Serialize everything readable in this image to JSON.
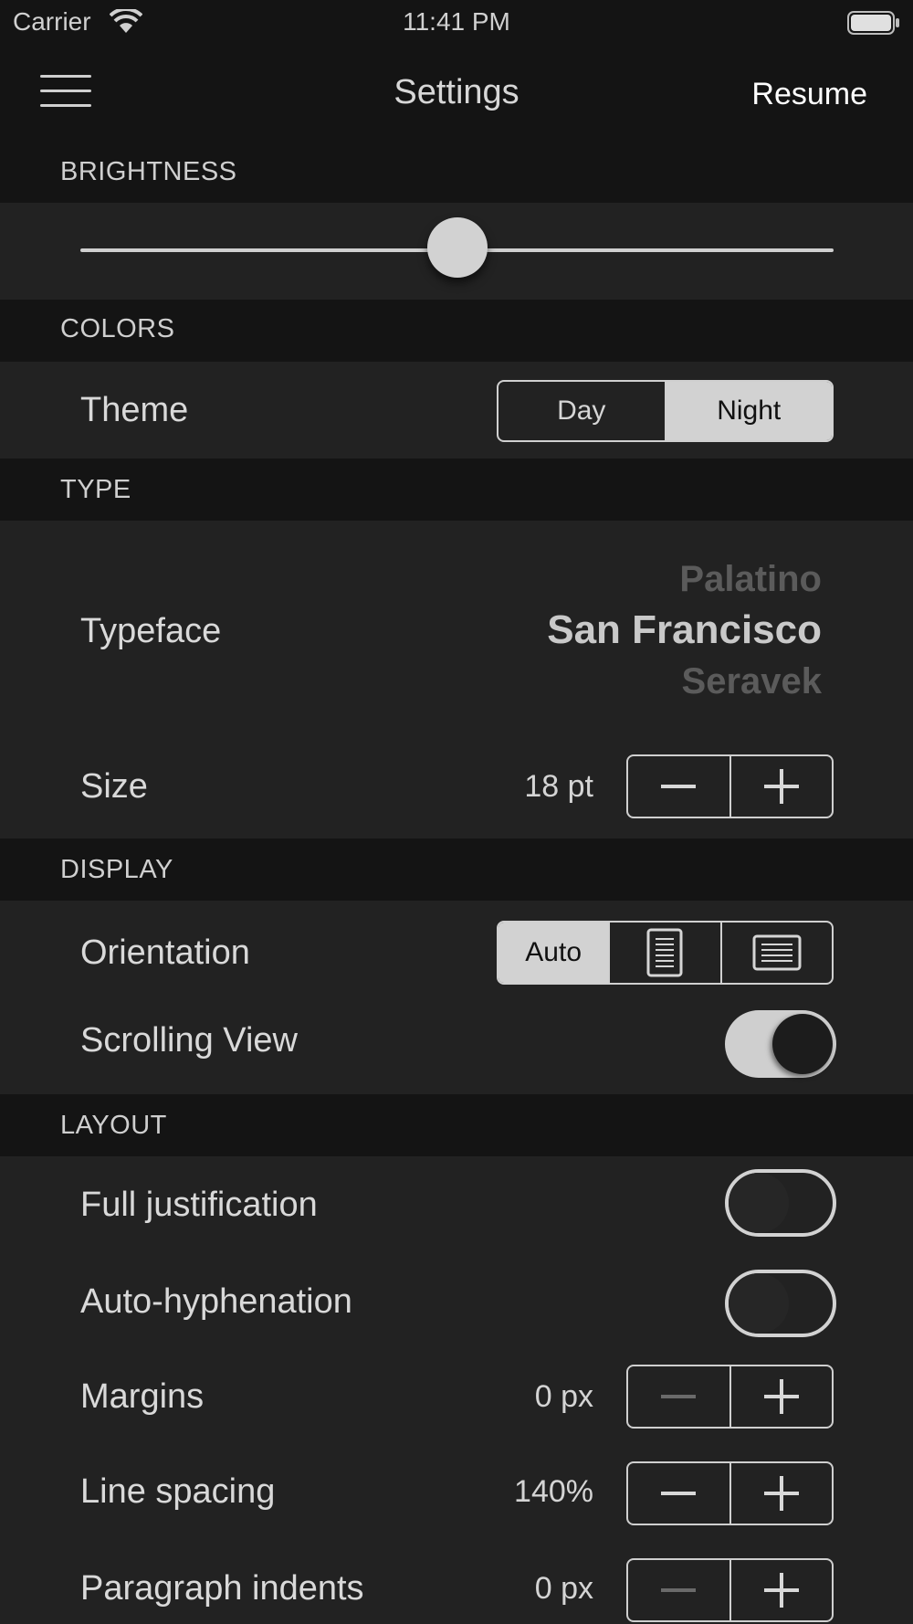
{
  "status_bar": {
    "carrier": "Carrier",
    "time": "11:41 PM"
  },
  "nav": {
    "title": "Settings",
    "resume": "Resume"
  },
  "sections": {
    "brightness": "BRIGHTNESS",
    "colors": "COLORS",
    "type": "TYPE",
    "display": "DISPLAY",
    "layout": "LAYOUT"
  },
  "brightness": {
    "level": 0.5
  },
  "colors": {
    "theme_label": "Theme",
    "theme_options": [
      "Day",
      "Night"
    ],
    "theme_selected": "Night"
  },
  "type": {
    "typeface_label": "Typeface",
    "typeface_above": "Palatino",
    "typeface_selected": "San Francisco",
    "typeface_below": "Seravek",
    "size_label": "Size",
    "size_value": "18 pt"
  },
  "display": {
    "orientation_label": "Orientation",
    "orientation_auto": "Auto",
    "orientation_selected": "Auto",
    "scrolling_label": "Scrolling View",
    "scrolling_on": true
  },
  "layout": {
    "justification_label": "Full justification",
    "justification_on": false,
    "hyphenation_label": "Auto-hyphenation",
    "hyphenation_on": false,
    "margins_label": "Margins",
    "margins_value": "0 px",
    "line_spacing_label": "Line spacing",
    "line_spacing_value": "140%",
    "indents_label": "Paragraph indents",
    "indents_value": "0 px"
  }
}
